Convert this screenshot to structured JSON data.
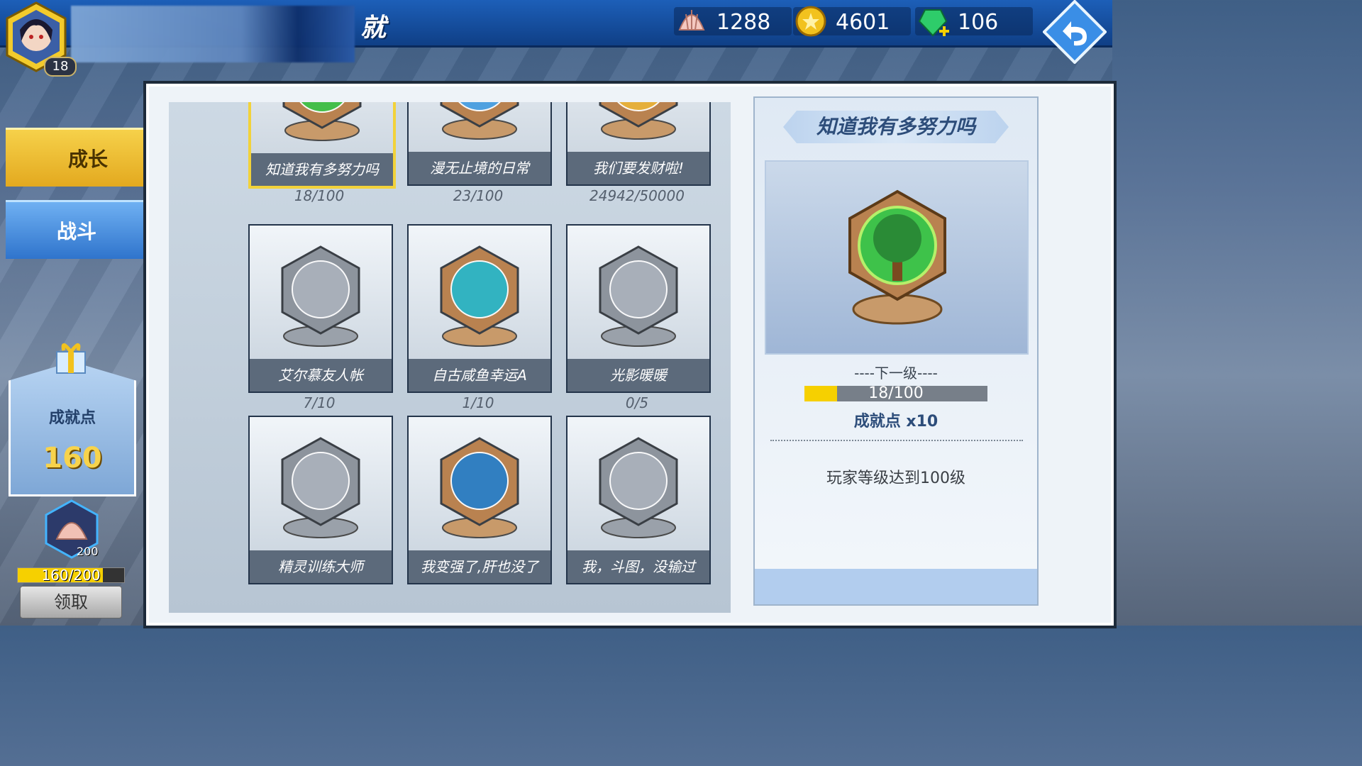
{
  "window": {
    "title": "就"
  },
  "player": {
    "level": "18"
  },
  "resources": [
    {
      "icon": "shell-icon",
      "value": "1288"
    },
    {
      "icon": "gold-coin-icon",
      "value": "4601"
    },
    {
      "icon": "green-gem-icon",
      "value": "106"
    }
  ],
  "tabs": [
    {
      "label": "成长",
      "active": true
    },
    {
      "label": "战斗",
      "active": false
    }
  ],
  "achievement_points": {
    "label": "成就点",
    "value": "160"
  },
  "shell_reward": {
    "count": "200",
    "progress_text": "160/200",
    "progress": 0.8,
    "claim_label": "领取"
  },
  "cards": [
    {
      "name": "知道我有多努力吗",
      "progress": "18/100",
      "selected": true
    },
    {
      "name": "漫无止境的日常",
      "progress": "23/100"
    },
    {
      "name": "我们要发财啦!",
      "progress": "24942/50000"
    },
    {
      "name": "艾尔慕友人帐",
      "progress": "7/10"
    },
    {
      "name": "自古咸鱼幸运A",
      "progress": "1/10"
    },
    {
      "name": "光影暖暖",
      "progress": "0/5"
    },
    {
      "name": "精灵训练大师",
      "progress": ""
    },
    {
      "name": "我变强了,肝也没了",
      "progress": ""
    },
    {
      "name": "我，斗图，没输过",
      "progress": ""
    }
  ],
  "detail": {
    "title": "知道我有多努力吗",
    "next_level_label": "----下一级----",
    "progress_text": "18/100",
    "progress": 0.18,
    "reward": "成就点 x10",
    "description": "玩家等级达到100级"
  },
  "colors": {
    "accent_yellow": "#f6d000",
    "tab_gold": "#e3a91f",
    "tab_blue": "#2f74cc"
  }
}
